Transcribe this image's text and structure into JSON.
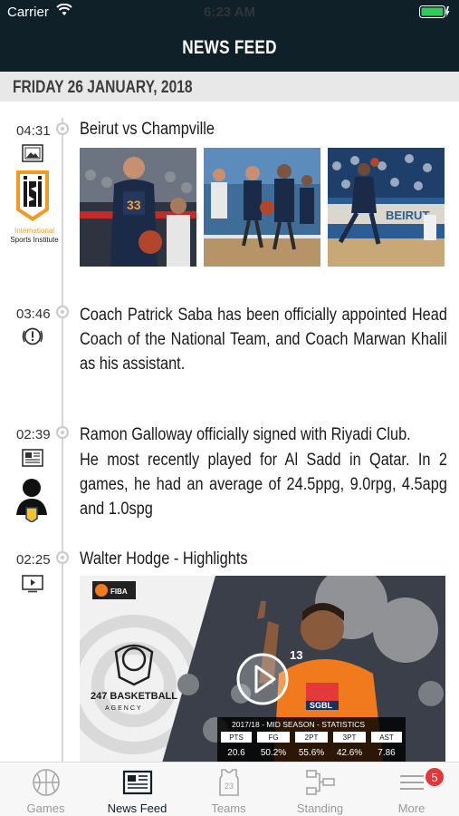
{
  "status_bar": {
    "carrier": "Carrier",
    "time": "6:23 AM"
  },
  "nav": {
    "title": "NEWS FEED"
  },
  "date_header": "FRIDAY 26 JANUARY, 2018",
  "feed": [
    {
      "time": "04:31",
      "type_icon": "image-icon",
      "title": "Beirut vs Champville",
      "sponsor": {
        "line1": "International",
        "line2": "Sports Institute",
        "logo_letters": "iSi"
      }
    },
    {
      "time": "03:46",
      "type_icon": "alert-icon",
      "body": "Coach Patrick Saba has been officially appointed Head Coach of the National Team, and Coach Marwan Khalil as his assistant."
    },
    {
      "time": "02:39",
      "type_icon": "article-icon",
      "title": "Ramon Galloway officially signed with Riyadi Club.",
      "body": "He most recently played for Al Sadd in Qatar. In 2 games, he had an average of 24.5ppg, 9.0rpg, 4.5apg and 1.0spg"
    },
    {
      "time": "02:25",
      "type_icon": "video-icon",
      "title": "Walter Hodge - Highlights",
      "video": {
        "agency": "247 BASKETBALL",
        "agency_sub": "AGENCY",
        "league_badge": "FIBA",
        "jersey": "13",
        "jersey_sponsor": "SGBL",
        "stats_title": "2017/18 - MID SEASON - STATISTICS",
        "stats_headers": [
          "PTS",
          "FG",
          "2PT",
          "3PT",
          "AST"
        ],
        "stats_values": [
          "20.6",
          "50.2%",
          "55.6%",
          "42.6%",
          "7.86"
        ]
      }
    }
  ],
  "tabs": [
    {
      "label": "Games",
      "icon": "basketball-icon"
    },
    {
      "label": "News Feed",
      "icon": "newspaper-icon",
      "active": true
    },
    {
      "label": "Teams",
      "icon": "jersey-icon",
      "jersey_number": "23"
    },
    {
      "label": "Standing",
      "icon": "bracket-icon"
    },
    {
      "label": "More",
      "icon": "menu-icon",
      "badge": "5"
    }
  ],
  "colors": {
    "header": "#0f2029",
    "battery": "#34c759",
    "badge": "#e5373a",
    "iSi_orange": "#f29a1d"
  }
}
